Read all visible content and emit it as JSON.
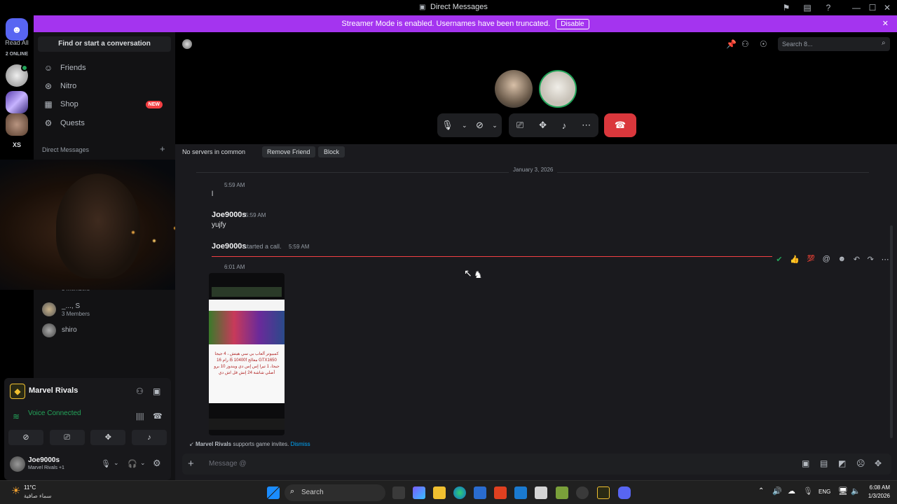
{
  "titlebar": {
    "title": "Direct Messages"
  },
  "rail": {
    "read_all": "Read All",
    "online": "2 ONLINE",
    "server_xs": "XS"
  },
  "banner": {
    "text": "Streamer Mode is enabled. Usernames have been truncated.",
    "disable": "Disable"
  },
  "sidebar": {
    "find": "Find or start a conversation",
    "nav": [
      "Friends",
      "Nitro",
      "Shop",
      "Quests"
    ],
    "new_badge": "NEW",
    "dm_header": "Direct Messages",
    "dms": [
      {
        "name": "",
        "sub": "3 Members"
      },
      {
        "name": "_..., S",
        "sub": "3 Members"
      },
      {
        "name": "shiro",
        "sub": ""
      }
    ]
  },
  "header": {
    "search_placeholder": "Search 8..."
  },
  "chat": {
    "no_servers": "No servers in common",
    "remove_friend": "Remove Friend",
    "block": "Block",
    "date": "January 3, 2026",
    "messages": [
      {
        "time": "5:59 AM",
        "text": "l"
      },
      {
        "author": "Joe9000s",
        "time": "5:59 AM",
        "text": "yujfy"
      },
      {
        "author": "Joe9000s",
        "text": "started a call.",
        "time": "5:59 AM"
      },
      {
        "time": "6:01 AM"
      }
    ],
    "attachment_text": "كمبيوتر ألعاب بي سي هيتش ، 4 جيجا GTX1650 معالج i5 10400f رام 16 جيجا، 1 تيرا إس إس دي ويندوز 10 برو أصلي شاشة 24 إنش قل اش دي",
    "game_invite": "Marvel Rivals",
    "game_invite_rest": "supports game invites.",
    "dismiss": "Dismiss",
    "message_placeholder": "Message @"
  },
  "voice": {
    "server": "Marvel Rivals",
    "status": "Voice Connected",
    "user": "Joe9000s",
    "activity": "Marvel Rivals +1"
  },
  "taskbar": {
    "weather_temp": "11°C",
    "weather_desc": "سماء صافية",
    "search": "Search",
    "lang": "ENG",
    "time": "6:08 AM",
    "date": "1/3/2026"
  },
  "colors": {
    "accent": "#a434ef",
    "discord": "#5865f2",
    "hangup": "#da373c",
    "green": "#23a55a"
  }
}
